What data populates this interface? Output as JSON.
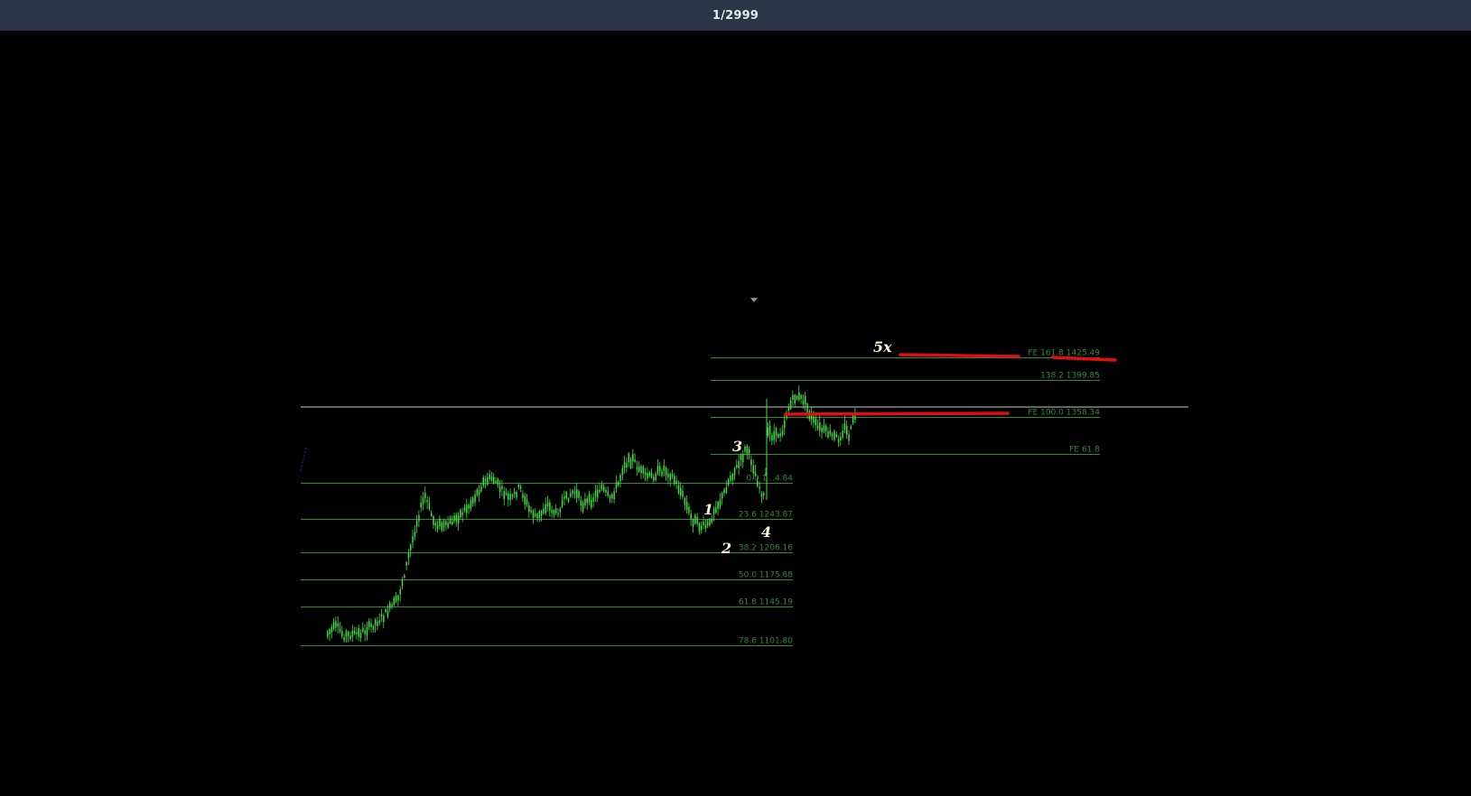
{
  "header": {
    "counter_text": "1/2999"
  },
  "chart_data": {
    "type": "candlestick",
    "colors": {
      "background": "#000000",
      "candle": "#3fe03f",
      "fib_line": "#2e8b2e",
      "fib_text": "#2e8b2e",
      "price_line": "#c8c8c8",
      "target_line": "#e01010",
      "wave_label": "#fff6d5"
    },
    "retracement_levels": [
      {
        "label": "0.0 1...4.84",
        "price": 1284.84
      },
      {
        "label": "23.6 1243.87",
        "price": 1243.87
      },
      {
        "label": "38.2 1206.16",
        "price": 1206.16
      },
      {
        "label": "50.0 1175.68",
        "price": 1175.68
      },
      {
        "label": "61.8 1145.19",
        "price": 1145.19
      },
      {
        "label": "78.6 1101.80",
        "price": 1101.8
      }
    ],
    "expansion_levels": [
      {
        "label": "FE 161.8 1425.49",
        "price": 1425.49
      },
      {
        "label": "138.2 1399.85",
        "price": 1399.85
      },
      {
        "label": "FE 100.0 1358.34",
        "price": 1358.34
      },
      {
        "label": "FE 61.8",
        "price": 1316.8
      }
    ],
    "current_price": 1350,
    "wave_labels": [
      "1",
      "2",
      "3",
      "4",
      "5x"
    ],
    "target_lines": 3
  }
}
